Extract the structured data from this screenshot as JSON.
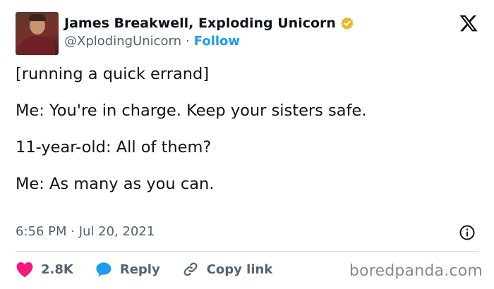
{
  "author": {
    "display_name": "James Breakwell, Exploding Unicorn",
    "handle": "@XplodingUnicorn",
    "separator": "·",
    "follow_label": "Follow"
  },
  "tweet": {
    "lines": [
      "[running a quick errand]",
      "Me: You're in charge. Keep your sisters safe.",
      "11-year-old: All of them?",
      "Me: As many as you can."
    ],
    "timestamp": "6:56 PM · Jul 20, 2021"
  },
  "actions": {
    "likes_count": "2.8K",
    "reply_label": "Reply",
    "copy_link_label": "Copy link"
  },
  "watermark": "boredpanda.com",
  "colors": {
    "accent": "#1d9bf0",
    "like": "#f91880",
    "verified": "#e8b829",
    "text": "#0f1419",
    "muted": "#536471"
  },
  "icons": [
    "verified-badge-icon",
    "x-logo-icon",
    "info-icon",
    "heart-icon",
    "reply-bubble-icon",
    "link-icon"
  ]
}
